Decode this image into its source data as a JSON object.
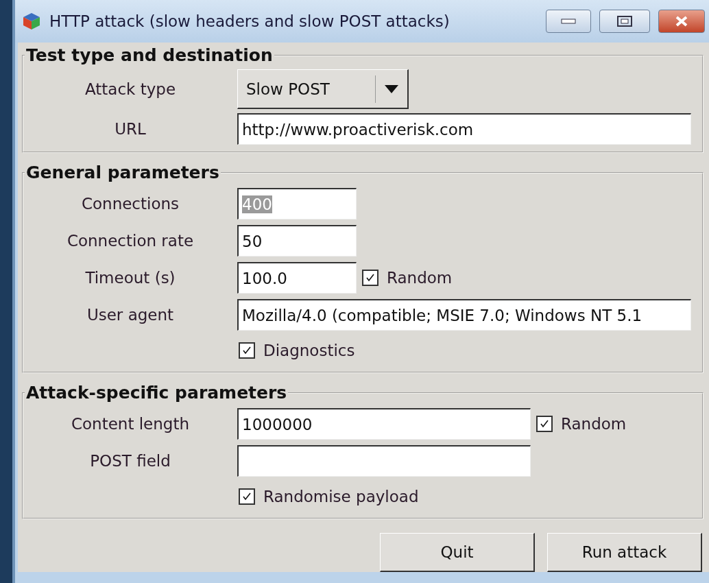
{
  "window": {
    "title": "HTTP attack (slow headers and slow POST attacks)"
  },
  "sections": [
    {
      "title": "Test type and destination",
      "rows": [
        {
          "kind": "dropdown",
          "label": "Attack type",
          "value": "Slow POST"
        },
        {
          "kind": "long_field",
          "label": "URL",
          "value": "http://www.proactiverisk.com"
        }
      ]
    },
    {
      "title": "General parameters",
      "rows": [
        {
          "kind": "short_field",
          "label": "Connections",
          "value": "400",
          "highlighted": true
        },
        {
          "kind": "short_field",
          "label": "Connection rate",
          "value": "50",
          "highlighted": false
        },
        {
          "kind": "short_field",
          "label": "Timeout (s)",
          "value": "100.0",
          "highlighted": false,
          "checkbox": {
            "label": "Random",
            "checked": true
          }
        },
        {
          "kind": "long_field",
          "label": "User agent",
          "value": "Mozilla/4.0 (compatible; MSIE 7.0; Windows NT 5.1"
        },
        {
          "kind": "checkbox",
          "label": "Diagnostics",
          "checked": true
        }
      ]
    },
    {
      "title": "Attack-specific parameters",
      "rows": [
        {
          "kind": "medium_field",
          "label": "Content length",
          "value": "1000000",
          "checkbox": {
            "label": "Random",
            "checked": true
          }
        },
        {
          "kind": "medium_field",
          "label": "POST field"
        },
        {
          "kind": "checkbox",
          "label": "Randomise payload",
          "checked": true
        }
      ]
    }
  ],
  "buttons": [
    "Quit",
    "Run attack"
  ]
}
